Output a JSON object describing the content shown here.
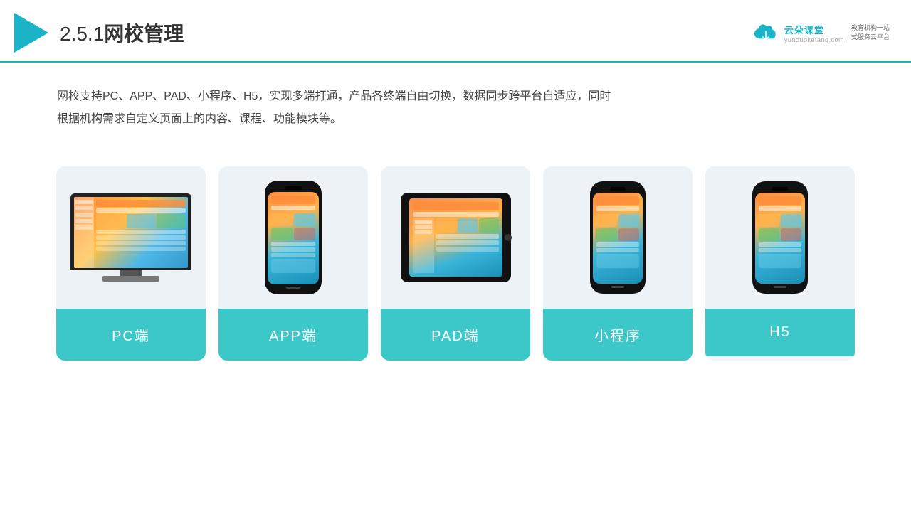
{
  "header": {
    "title_number": "2.5.1",
    "title_chinese": "网校管理",
    "brand": {
      "name": "云朵课堂",
      "url": "yunduoketang.com",
      "tagline": "教育机构一站\n式服务云平台"
    }
  },
  "description": {
    "text": "网校支持PC、APP、PAD、小程序、H5，实现多端打通，产品各终端自由切换，数据同步跨平台自适应，同时根据机构需求自定义页面上的内容、课程、功能模块等。"
  },
  "cards": [
    {
      "id": "pc",
      "label": "PC端",
      "device": "pc"
    },
    {
      "id": "app",
      "label": "APP端",
      "device": "phone"
    },
    {
      "id": "pad",
      "label": "PAD端",
      "device": "tablet"
    },
    {
      "id": "miniapp",
      "label": "小程序",
      "device": "phone"
    },
    {
      "id": "h5",
      "label": "H5",
      "device": "phone"
    }
  ],
  "colors": {
    "accent": "#3cc8c8",
    "header_line": "#1ab3c8",
    "text_dark": "#333333",
    "text_body": "#444444",
    "card_bg": "#edf2f7"
  }
}
